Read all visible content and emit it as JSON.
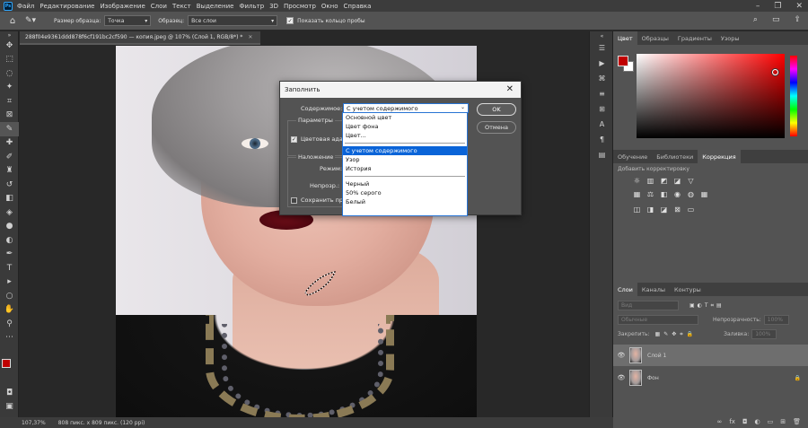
{
  "app": {
    "logo": "Ps"
  },
  "menu": [
    "Файл",
    "Редактирование",
    "Изображение",
    "Слои",
    "Текст",
    "Выделение",
    "Фильтр",
    "3D",
    "Просмотр",
    "Окно",
    "Справка"
  ],
  "options": {
    "sample_size_label": "Размер образца:",
    "sample_size_value": "Точка",
    "sample_label": "Образец:",
    "sample_value": "Все слои",
    "show_ring_label": "Показать кольцо пробы"
  },
  "document": {
    "tab_title": "288f04e9361ddd878f6cf191bc2cf590 — копия.jpeg @ 107% (Слой 1, RGB/8*) *"
  },
  "status": {
    "zoom": "107,37%",
    "doc_info": "808 пикс. x 809 пикс. (120 ppi)"
  },
  "dialog": {
    "title": "Заполнить",
    "content_label": "Содержимое:",
    "content_value": "С учетом содержимого",
    "params_label": "Параметры",
    "color_adapt_label": "Цветовая адаптация",
    "blending_label": "Наложение",
    "mode_label": "Режим:",
    "opacity_label": "Непрозр.:",
    "preserve_label": "Сохранить прозрачность",
    "ok": "OK",
    "cancel": "Отмена",
    "dropdown": {
      "group1": [
        "Основной цвет",
        "Цвет фона",
        "Цвет..."
      ],
      "group2": [
        "С учетом содержимого",
        "Узор",
        "История"
      ],
      "group3": [
        "Черный",
        "50% серого",
        "Белый"
      ],
      "selected": "С учетом содержимого"
    }
  },
  "color_panel": {
    "tabs": [
      "Цвет",
      "Образцы",
      "Градиенты",
      "Узоры"
    ],
    "foreground": "#c00000",
    "background": "#ffffff"
  },
  "adjust_panel": {
    "tabs": [
      "Обучение",
      "Библиотеки",
      "Коррекция"
    ],
    "hint": "Добавить корректировку"
  },
  "layers_panel": {
    "tabs": [
      "Слои",
      "Каналы",
      "Контуры"
    ],
    "search_placeholder": "Вид",
    "blend_mode": "Обычные",
    "opacity_label": "Непрозрачность:",
    "opacity_value": "100%",
    "lock_label": "Закрепить:",
    "fill_label": "Заливка:",
    "fill_value": "100%",
    "layers": [
      {
        "name": "Слой 1",
        "active": true
      },
      {
        "name": "Фон",
        "active": false
      }
    ]
  }
}
